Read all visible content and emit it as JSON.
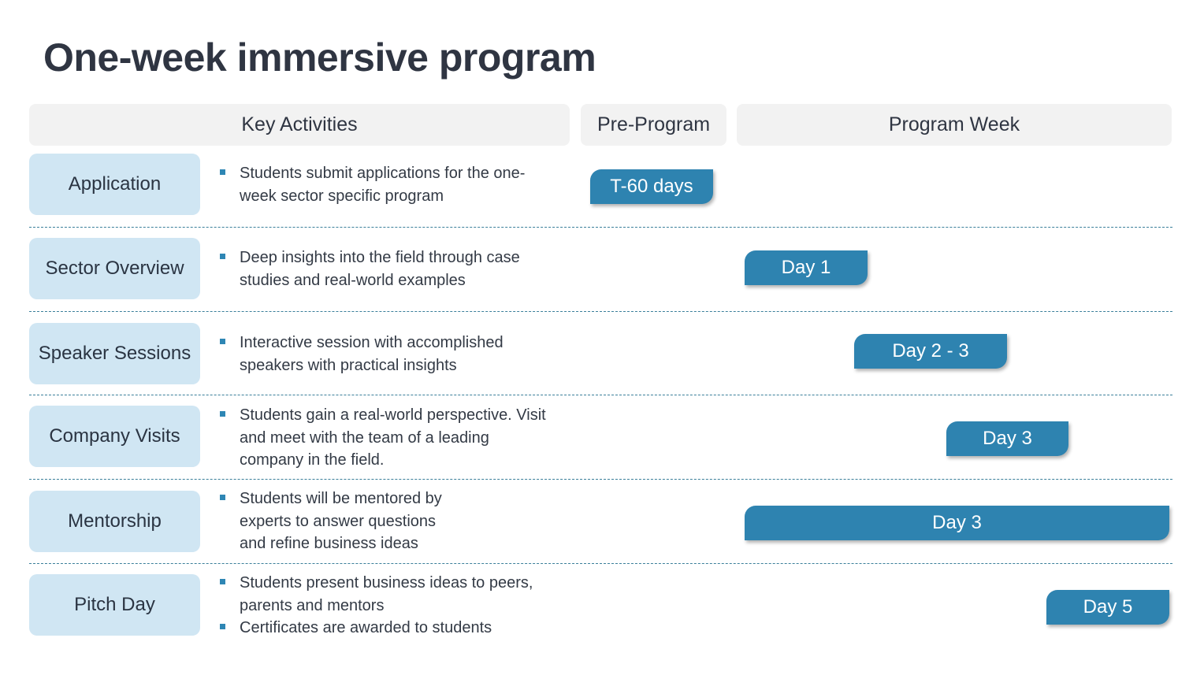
{
  "title": "One-week immersive program",
  "headers": {
    "key_activities": "Key Activities",
    "pre_program": "Pre-Program",
    "program_week": "Program Week"
  },
  "rows": [
    {
      "label": "Application",
      "bullets": [
        "Students submit applications for the one-week sector specific program"
      ],
      "pill": "T-60 days"
    },
    {
      "label": "Sector Overview",
      "bullets": [
        "Deep insights into the field through case studies and real-world examples"
      ],
      "pill": "Day 1"
    },
    {
      "label": "Speaker Sessions",
      "bullets": [
        "Interactive session with accomplished speakers with practical insights"
      ],
      "pill": "Day 2 - 3"
    },
    {
      "label": "Company Visits",
      "bullets": [
        "Students gain a real-world perspective. Visit and meet with the team of a leading company in the field."
      ],
      "pill": "Day 3"
    },
    {
      "label": "Mentorship",
      "bullets": [
        "Students will be mentored by experts to answer questions and refine business ideas"
      ],
      "pill": "Day 3"
    },
    {
      "label": "Pitch Day",
      "bullets": [
        "Students present business ideas to peers, parents and mentors",
        "Certificates are awarded to students"
      ],
      "pill": "Day 5"
    }
  ],
  "colors": {
    "accent": "#2e83b0",
    "label_bg": "#d0e6f3",
    "header_bg": "#f2f2f2",
    "divider": "#3a7f9a"
  }
}
